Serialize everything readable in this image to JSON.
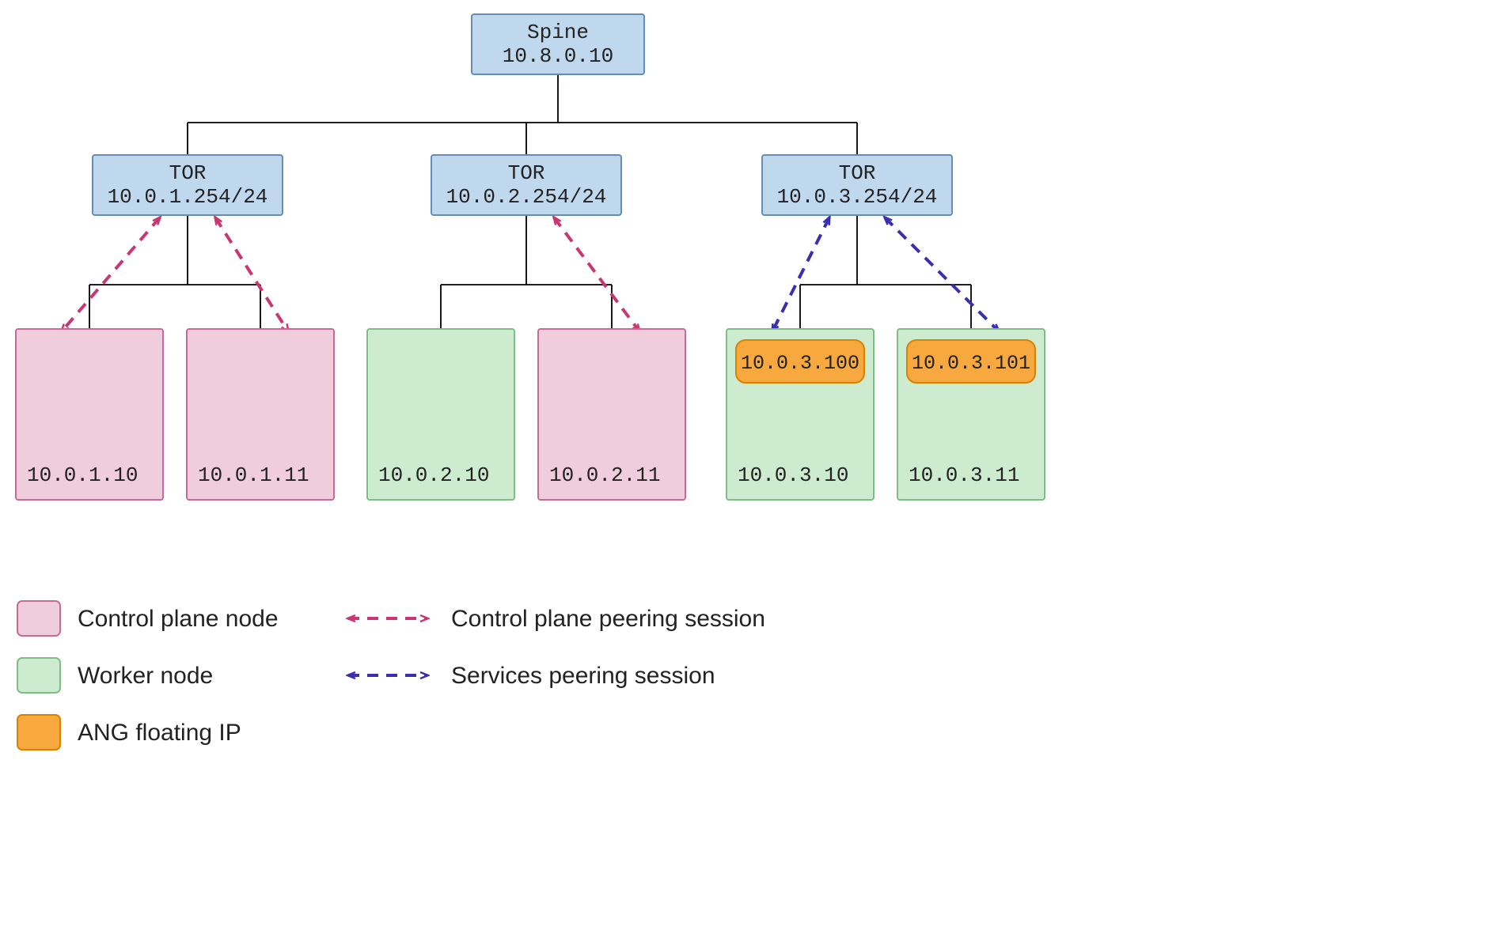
{
  "colors": {
    "spine_fill": "#C0D8EE",
    "spine_stroke": "#668CB3",
    "tor_fill": "#C0D8EE",
    "tor_stroke": "#668CB3",
    "control_plane_fill": "#EFCDDC",
    "control_plane_stroke": "#C56B96",
    "worker_fill": "#CDEBCF",
    "worker_stroke": "#7CBE83",
    "floating_fill": "#F7A940",
    "floating_stroke": "#D98200",
    "cp_arrow": "#C83771",
    "sv_arrow": "#3A2FB0",
    "text": "#222222"
  },
  "spine": {
    "label": "Spine",
    "ip": "10.8.0.10"
  },
  "tors": [
    {
      "label": "TOR",
      "ip": "10.0.1.254/24"
    },
    {
      "label": "TOR",
      "ip": "10.0.2.254/24"
    },
    {
      "label": "TOR",
      "ip": "10.0.3.254/24"
    }
  ],
  "nodes": [
    {
      "ip": "10.0.1.10",
      "type": "control"
    },
    {
      "ip": "10.0.1.11",
      "type": "control"
    },
    {
      "ip": "10.0.2.10",
      "type": "worker"
    },
    {
      "ip": "10.0.2.11",
      "type": "control"
    },
    {
      "ip": "10.0.3.10",
      "type": "worker"
    },
    {
      "ip": "10.0.3.11",
      "type": "worker"
    }
  ],
  "floating_ips": [
    {
      "ip": "10.0.3.100",
      "host_index": 4
    },
    {
      "ip": "10.0.3.101",
      "host_index": 5
    }
  ],
  "peering": [
    {
      "tor": 0,
      "node": 0,
      "kind": "control"
    },
    {
      "tor": 0,
      "node": 1,
      "kind": "control"
    },
    {
      "tor": 1,
      "node": 3,
      "kind": "control"
    },
    {
      "tor": 2,
      "node": 4,
      "kind": "service"
    },
    {
      "tor": 2,
      "node": 5,
      "kind": "service"
    }
  ],
  "legend": {
    "control_plane_node": "Control plane node",
    "worker_node": "Worker node",
    "floating_ip": "ANG floating IP",
    "control_peering": "Control plane peering session",
    "service_peering": "Services peering session"
  }
}
